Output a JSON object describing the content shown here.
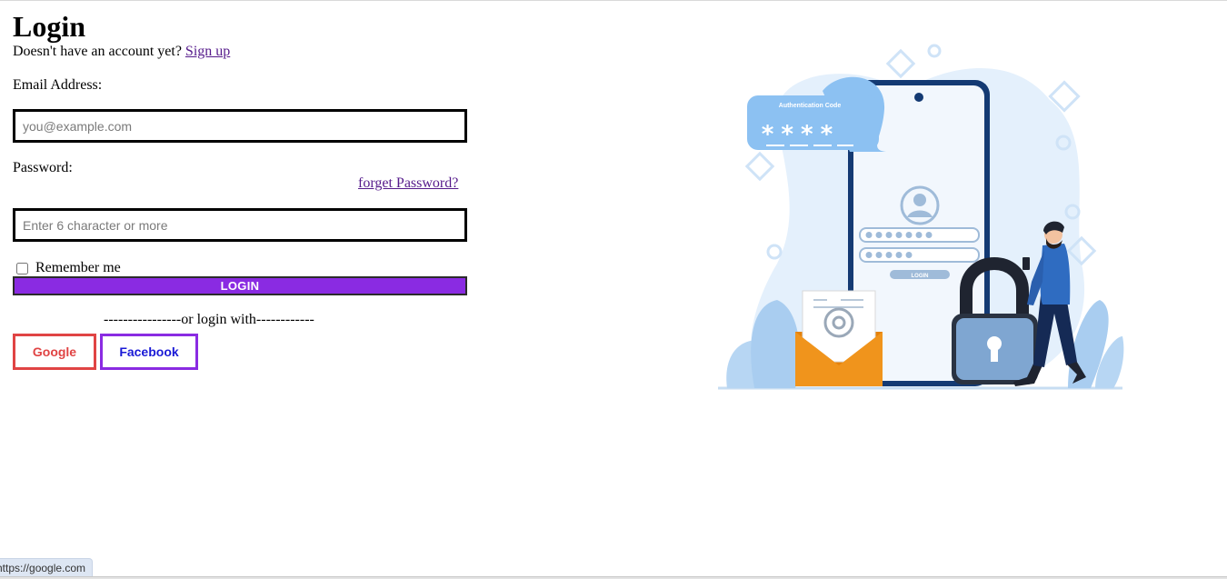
{
  "page": {
    "title": "Login",
    "signup_prompt": "Doesn't have an account yet?",
    "signup_link": "Sign up"
  },
  "form": {
    "email_label": "Email Address:",
    "email_placeholder": "you@example.com",
    "email_value": "",
    "password_label": "Password:",
    "forget_password": "forget Password?",
    "password_placeholder": "Enter 6 character or more",
    "password_value": "",
    "remember_label": "Remember me",
    "remember_checked": false,
    "login_button": "LOGIN",
    "divider": "----------------or login with------------"
  },
  "social": {
    "google": "Google",
    "facebook": "Facebook"
  },
  "illustration": {
    "auth_code_label": "Authentication Code",
    "auth_code_mask": "****",
    "phone_login_button": "LOGIN",
    "icons": [
      "chat-bubble-icon",
      "user-avatar-icon",
      "envelope-at-icon",
      "padlock-icon",
      "person-with-phone-icon"
    ]
  },
  "status_bar": {
    "url": "https://google.com"
  },
  "colors": {
    "login_button_bg": "#8a2be2",
    "google_border": "#e04444",
    "facebook_border": "#8a2be2",
    "facebook_text": "#1a1ad6",
    "link": "#551a8b"
  }
}
